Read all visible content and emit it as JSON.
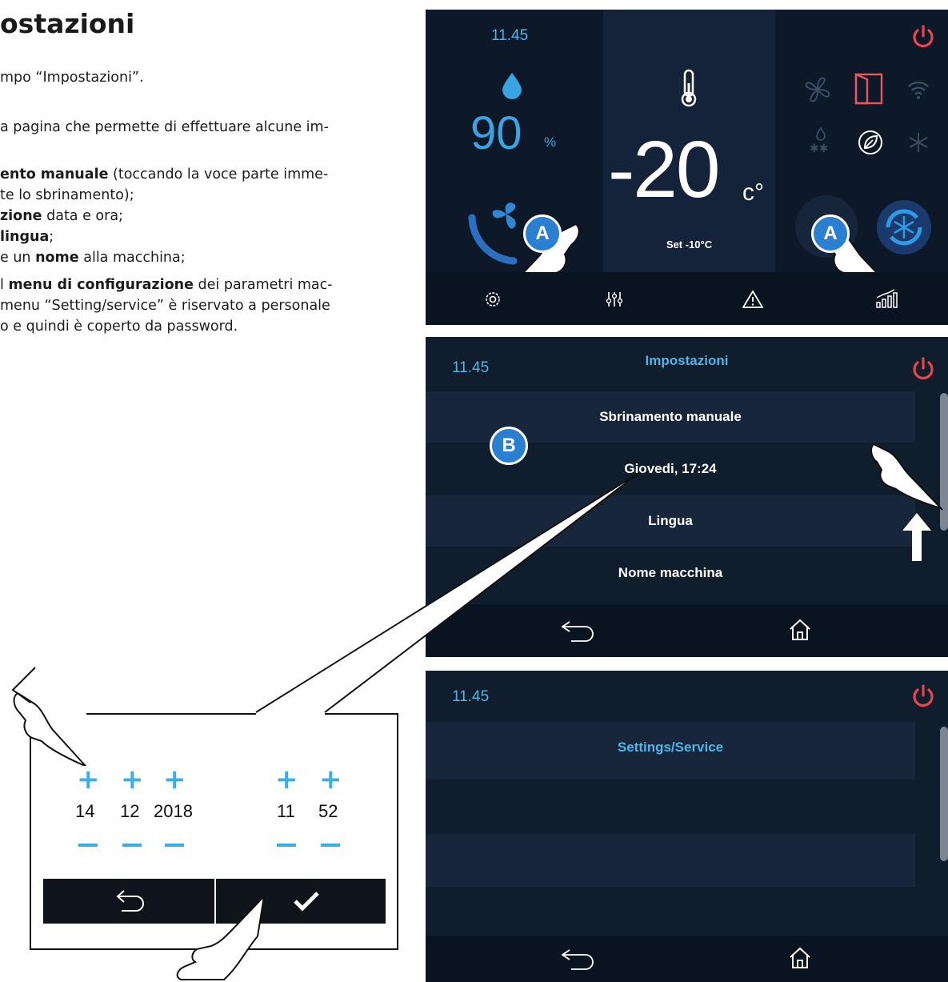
{
  "doc": {
    "title": "ostazioni",
    "lines": [
      {
        "parts": [
          {
            "t": "mpo “Impostazioni”.",
            "b": false
          }
        ]
      },
      {
        "parts": [
          {
            "t": "a pagina che permette di effettuare alcune im-",
            "b": false
          }
        ]
      },
      {
        "parts": [
          {
            "t": "ento manuale",
            "b": true
          },
          {
            "t": " (toccando la voce parte imme-",
            "b": false
          }
        ]
      },
      {
        "parts": [
          {
            "t": "te lo sbrinamento);",
            "b": false
          }
        ]
      },
      {
        "parts": [
          {
            "t": "zione",
            "b": true
          },
          {
            "t": " data e ora;",
            "b": false
          }
        ]
      },
      {
        "parts": [
          {
            "t": "lingua",
            "b": true
          },
          {
            "t": ";",
            "b": false
          }
        ]
      },
      {
        "parts": [
          {
            "t": "e un ",
            "b": false
          },
          {
            "t": "nome",
            "b": true
          },
          {
            "t": " alla macchina;",
            "b": false
          }
        ]
      },
      {
        "parts": [
          {
            "t": "l ",
            "b": false
          },
          {
            "t": "menu di configurazione",
            "b": true
          },
          {
            "t": " dei parametri mac-",
            "b": false
          }
        ]
      },
      {
        "parts": [
          {
            "t": "menu “Setting/service” è riservato a personale",
            "b": false
          }
        ]
      },
      {
        "parts": [
          {
            "t": "o e quindi è coperto da password.",
            "b": false
          }
        ]
      }
    ]
  },
  "screen1": {
    "time": "11.45",
    "humidity_value": "90",
    "humidity_unit": "%",
    "temperature_value": "-20",
    "temperature_unit": "c°",
    "setpoint": "Set -10°C",
    "badge_left": "A",
    "badge_right": "A"
  },
  "screen2": {
    "time": "11.45",
    "title": "Impostazioni",
    "badge": "B",
    "menu_items": [
      "Sbrinamento manuale",
      "Giovedi, 17:24",
      "Lingua",
      "Nome macchina"
    ]
  },
  "screen3": {
    "time": "11.45",
    "title": "Settings/Service"
  },
  "datetime_editor": {
    "day": "14",
    "month": "12",
    "year": "2018",
    "hour": "11",
    "minute": "52"
  },
  "colors": {
    "accent_blue": "#4fb5e8",
    "power_red": "#e8454f",
    "panel_dark": "#0f1b2a"
  }
}
